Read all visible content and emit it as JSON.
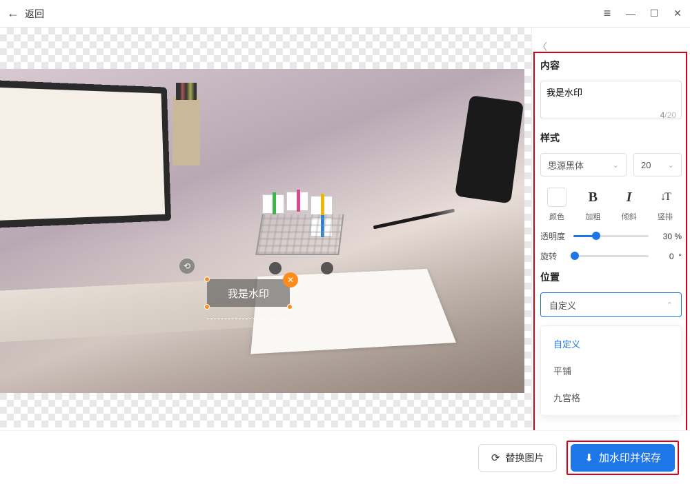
{
  "titlebar": {
    "back_label": "返回"
  },
  "watermark": {
    "text": "我是水印"
  },
  "panel": {
    "section_content": "内容",
    "textarea_value": "我是水印",
    "char_current": "4",
    "char_max": "20",
    "section_style": "样式",
    "font_select": "思源黑体",
    "size_select": "20",
    "style_labels": {
      "color": "颜色",
      "bold": "加粗",
      "italic": "倾斜",
      "vertical": "竖排"
    },
    "opacity_label": "透明度",
    "opacity_value": "30 %",
    "opacity_percent": 30,
    "rotate_label": "旋转",
    "rotate_value": "0",
    "rotate_unit": "°",
    "rotate_percent": 2,
    "section_position": "位置",
    "position_selected": "自定义",
    "position_options": [
      "自定义",
      "平铺",
      "九宫格"
    ]
  },
  "bottom": {
    "replace_label": "替换图片",
    "save_label": "加水印并保存"
  }
}
